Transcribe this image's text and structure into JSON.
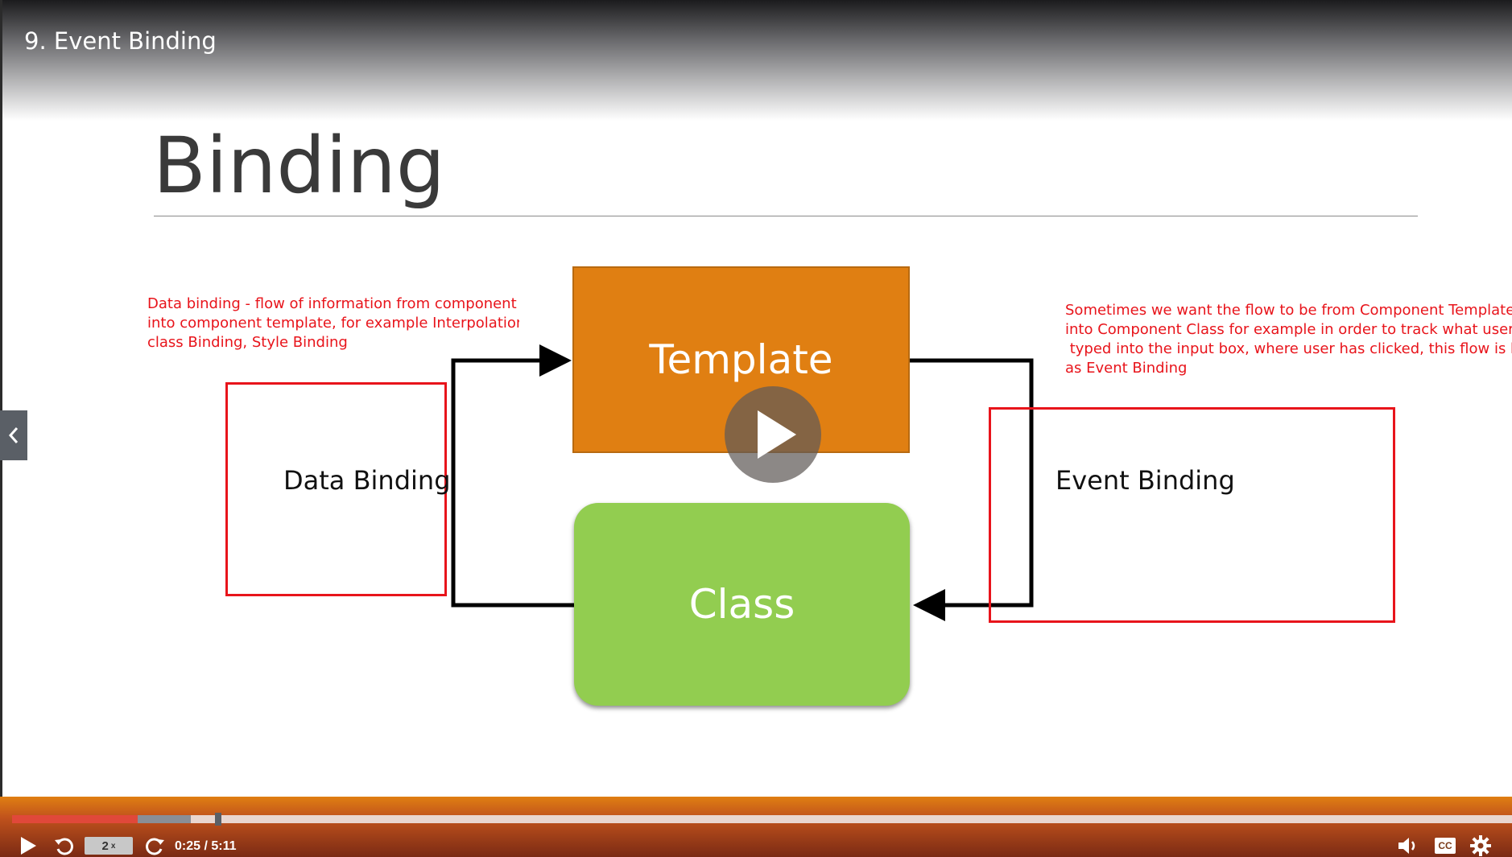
{
  "player": {
    "video_title": "9. Event Binding",
    "current_time": "0:25",
    "time_separator": "/",
    "duration": "5:11",
    "playback_rate": "2",
    "playback_rate_suffix": "x",
    "progress_played_fraction": 0.084,
    "progress_buffered_fraction": 0.119,
    "icons": {
      "play": "play-icon",
      "rewind": "rewind-icon",
      "forward": "forward-icon",
      "volume": "volume-icon",
      "captions": "captions-icon",
      "settings": "gear-icon",
      "big_play": "play-icon",
      "previous": "chevron-left-icon"
    },
    "captions_label": "CC"
  },
  "slide": {
    "title": "Binding",
    "template_label": "Template",
    "class_label": "Class",
    "data_binding_label": "Data Binding",
    "event_binding_label": "Event Binding",
    "annotation_left": [
      "Data binding - flow of information from component cla",
      "into component template, for example Interpolation,",
      "class Binding, Style Binding"
    ],
    "annotation_right": [
      "Sometimes we want the flow to be from Component Template",
      "into Component Class for example in order to track what user has",
      " typed into the input box, where user has clicked, this flow is know",
      "as Event Binding"
    ]
  },
  "colors": {
    "template_fill": "#e07f12",
    "class_fill": "#92cd50",
    "annotation_red": "#e8141b",
    "progress_played": "#e0483a"
  }
}
